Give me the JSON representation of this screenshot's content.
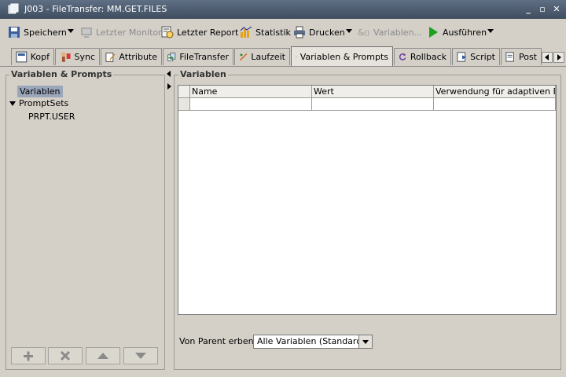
{
  "window": {
    "title": "J003 - FileTransfer: MM.GET.FILES"
  },
  "toolbar": {
    "save": "Speichern",
    "last_monitor": "Letzter Monitor",
    "last_report": "Letzter Report",
    "statistics": "Statistik",
    "print": "Drucken",
    "variables": "Variablen...",
    "execute": "Ausführen"
  },
  "tabs": [
    "Kopf",
    "Sync",
    "Attribute",
    "FileTransfer",
    "Laufzeit",
    "Variablen & Prompts",
    "Rollback",
    "Script",
    "Post"
  ],
  "left_panel": {
    "title": "Variablen & Prompts",
    "tree": [
      {
        "label": "Variablen",
        "selected": true
      },
      {
        "label": "PromptSets",
        "expanded": true
      },
      {
        "label": "PRPT.USER"
      }
    ],
    "buttons": [
      "add-icon",
      "delete-icon",
      "up-arrow-icon",
      "down-arrow-icon"
    ]
  },
  "right_panel": {
    "title": "Variablen",
    "columns": [
      "Name",
      "Wert",
      "Verwendung für adaptiven E..."
    ],
    "inherit_label": "Von Parent erben:",
    "inherit_value": "Alle Variablen (Standard)"
  },
  "colors": {
    "titlebar": "#4a586c",
    "selection": "#9aa7bb",
    "panel": "#d4d0c8"
  }
}
